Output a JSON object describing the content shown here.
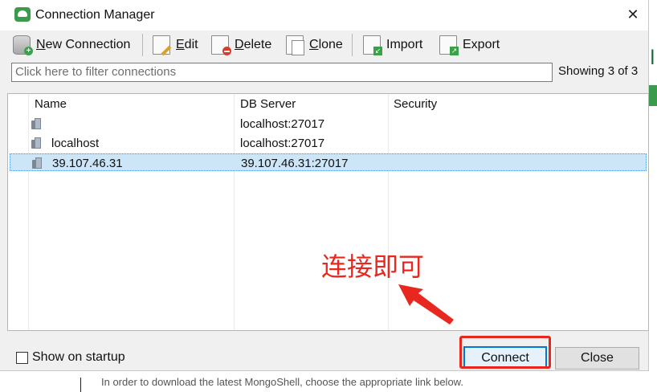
{
  "window": {
    "title": "Connection Manager",
    "close_glyph": "✕"
  },
  "toolbar": {
    "new_connection": {
      "accel": "N",
      "rest": "ew Connection",
      "icon": "database-add-icon"
    },
    "edit": {
      "accel": "E",
      "rest": "dit",
      "icon": "edit-icon"
    },
    "delete": {
      "accel": "D",
      "rest": "elete",
      "icon": "delete-icon"
    },
    "clone": {
      "accel": "C",
      "rest": "lone",
      "icon": "clone-icon"
    },
    "import": {
      "label": "Import",
      "icon": "import-icon"
    },
    "export": {
      "label": "Export",
      "icon": "export-icon"
    }
  },
  "filter": {
    "placeholder": "Click here to filter connections",
    "showing": "Showing 3 of 3"
  },
  "table": {
    "columns": [
      "Name",
      "DB Server",
      "Security"
    ],
    "rows": [
      {
        "name": "",
        "server": "localhost:27017",
        "security": "",
        "selected": false
      },
      {
        "name": "localhost",
        "server": "localhost:27017",
        "security": "",
        "selected": false
      },
      {
        "name": "39.107.46.31",
        "server": "39.107.46.31:27017",
        "security": "",
        "selected": true
      }
    ]
  },
  "annotation": {
    "text": "连接即可",
    "color": "#e8281e"
  },
  "footer": {
    "show_on_startup": "Show on startup",
    "show_on_startup_checked": false,
    "connect": "Connect",
    "close": "Close"
  },
  "background": {
    "right_letter": "l",
    "bottom_text": "In order to download the latest MongoShell, choose the appropriate link below."
  },
  "colors": {
    "accent": "#0078d7",
    "selection": "#cce6f8",
    "brand": "#3b9a4c"
  }
}
